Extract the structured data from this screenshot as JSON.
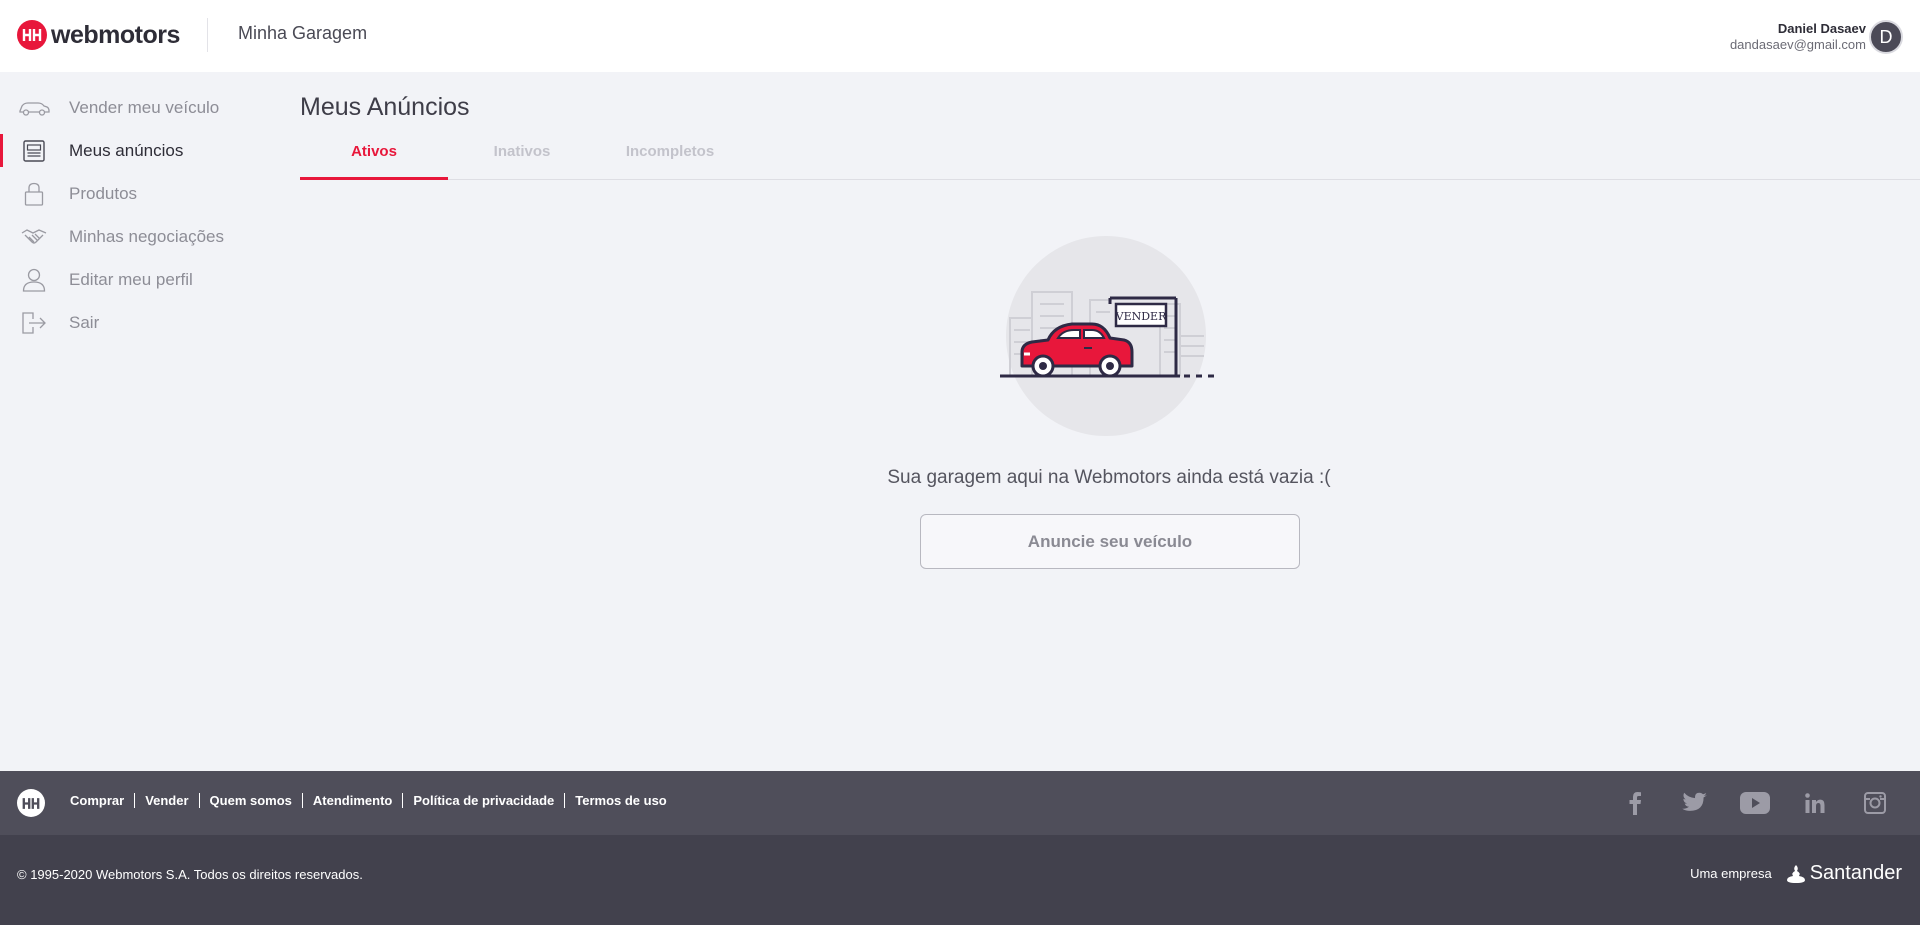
{
  "header": {
    "logo_text": "webmotors",
    "title": "Minha Garagem",
    "user_name": "Daniel Dasaev",
    "user_email": "dandasaev@gmail.com",
    "avatar_initial": "D"
  },
  "sidebar": {
    "items": [
      {
        "label": "Vender meu veículo",
        "icon": "car-icon"
      },
      {
        "label": "Meus anúncios",
        "icon": "listing-icon",
        "active": true
      },
      {
        "label": "Produtos",
        "icon": "lock-icon"
      },
      {
        "label": "Minhas negociações",
        "icon": "handshake-icon"
      },
      {
        "label": "Editar meu perfil",
        "icon": "user-icon"
      },
      {
        "label": "Sair",
        "icon": "logout-icon"
      }
    ]
  },
  "main": {
    "title": "Meus Anúncios",
    "tabs": [
      {
        "label": "Ativos",
        "active": true
      },
      {
        "label": "Inativos"
      },
      {
        "label": "Incompletos"
      }
    ],
    "sign_text": "VENDER",
    "empty_message": "Sua garagem aqui na Webmotors ainda está vazia :(",
    "cta_label": "Anuncie seu veículo"
  },
  "footer": {
    "links": [
      "Comprar",
      "Vender",
      "Quem somos",
      "Atendimento",
      "Política de privacidade",
      "Termos de uso"
    ],
    "social": [
      "facebook-icon",
      "twitter-icon",
      "youtube-icon",
      "linkedin-icon",
      "instagram-icon"
    ],
    "copyright": "© 1995-2020 Webmotors S.A. Todos os direitos reservados.",
    "company_prefix": "Uma empresa",
    "company_name": "Santander"
  },
  "colors": {
    "brand": "#e8173b",
    "footer_top": "#4f4e5a",
    "footer_bottom": "#42414d",
    "background": "#f2f3f7"
  }
}
